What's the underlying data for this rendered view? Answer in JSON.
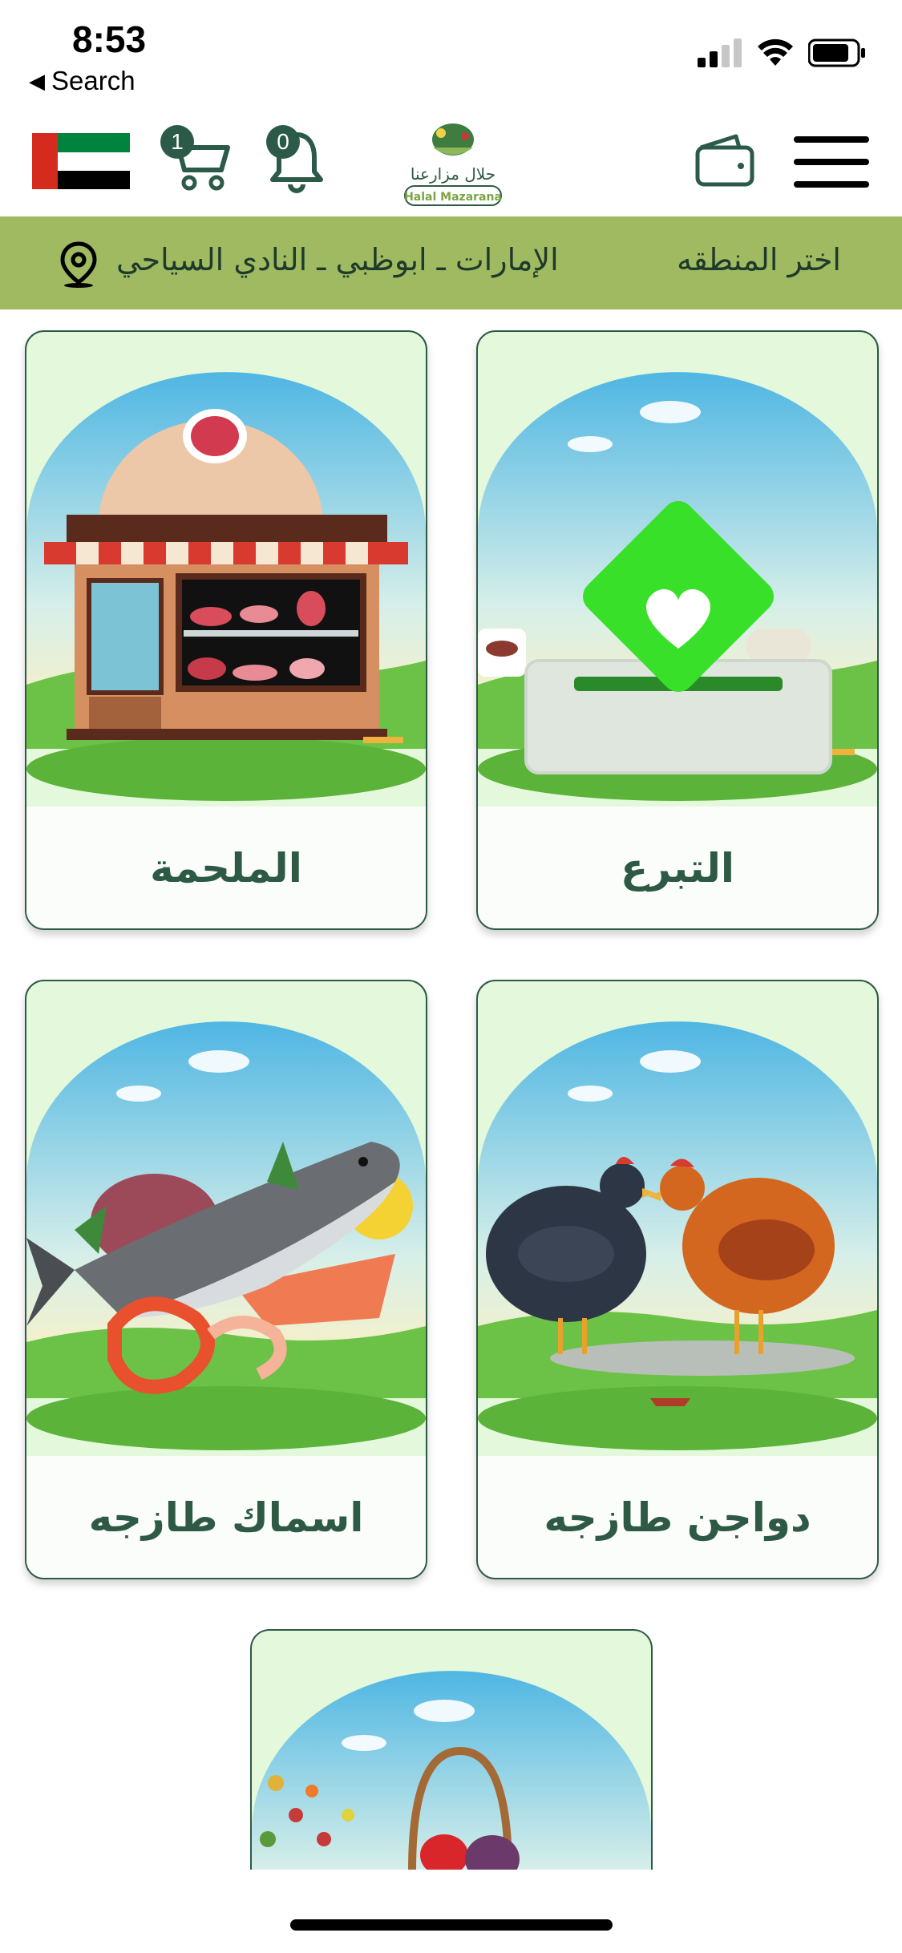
{
  "status_bar": {
    "time": "8:53",
    "back_label": "Search"
  },
  "header": {
    "cart_count": "1",
    "notification_count": "0",
    "logo_text_ar": "حلال مزارعنا",
    "logo_text_en": "Halal Mazarana"
  },
  "location": {
    "label": "اختر المنطقه",
    "value": "الإمارات ـ ابوظبي ـ النادي السياحي"
  },
  "categories": [
    {
      "label": "التبرع",
      "icon": "donation-box-icon"
    },
    {
      "label": "الملحمة",
      "icon": "butcher-shop-icon"
    },
    {
      "label": "دواجن طازجه",
      "icon": "chickens-icon"
    },
    {
      "label": "اسماك طازجه",
      "icon": "seafood-icon"
    },
    {
      "label": "",
      "icon": "vegetables-basket-icon"
    }
  ],
  "colors": {
    "accent": "#2e5a45",
    "location_bar": "#9fba60",
    "card_bg": "#e4f8dc"
  }
}
